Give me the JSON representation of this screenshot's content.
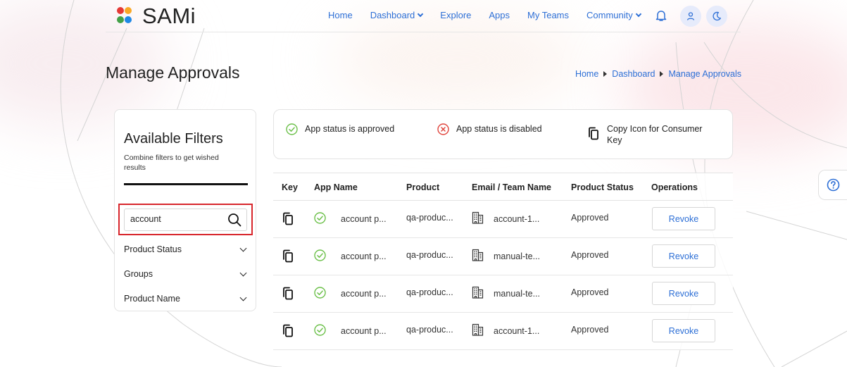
{
  "header": {
    "logo_text": "SAMi",
    "nav": [
      {
        "label": "Home",
        "has_menu": false
      },
      {
        "label": "Dashboard",
        "has_menu": true
      },
      {
        "label": "Explore",
        "has_menu": false
      },
      {
        "label": "Apps",
        "has_menu": false
      },
      {
        "label": "My Teams",
        "has_menu": false
      },
      {
        "label": "Community",
        "has_menu": true
      }
    ],
    "icons": [
      "bell-icon",
      "user-icon",
      "moon-icon"
    ]
  },
  "page": {
    "title": "Manage Approvals",
    "breadcrumb": [
      "Home",
      "Dashboard",
      "Manage Approvals"
    ]
  },
  "filters": {
    "title": "Available Filters",
    "subtitle": "Combine filters to get wished results",
    "search_value": "account",
    "sections": [
      "Product Status",
      "Groups",
      "Product Name"
    ]
  },
  "legend": {
    "approved": "App status is approved",
    "disabled": "App status is disabled",
    "copy": "Copy Icon for Consumer Key"
  },
  "table": {
    "headers": [
      "Key",
      "App Name",
      "Product",
      "Email / Team Name",
      "Product Status",
      "Operations"
    ],
    "rows": [
      {
        "app_name": "account p...",
        "product": "qa-produc...",
        "team": "account-1...",
        "status": "Approved",
        "action": "Revoke"
      },
      {
        "app_name": "account p...",
        "product": "qa-produc...",
        "team": "manual-te...",
        "status": "Approved",
        "action": "Revoke"
      },
      {
        "app_name": "account p...",
        "product": "qa-produc...",
        "team": "manual-te...",
        "status": "Approved",
        "action": "Revoke"
      },
      {
        "app_name": "account p...",
        "product": "qa-produc...",
        "team": "account-1...",
        "status": "Approved",
        "action": "Revoke"
      }
    ]
  },
  "colors": {
    "link": "#2d6fd6",
    "approved": "#6cc04a",
    "disabled": "#e0443c",
    "highlight": "#d8262c",
    "logo_dots": [
      "#e53935",
      "#f9a825",
      "#43a047",
      "#1e88e5"
    ]
  }
}
